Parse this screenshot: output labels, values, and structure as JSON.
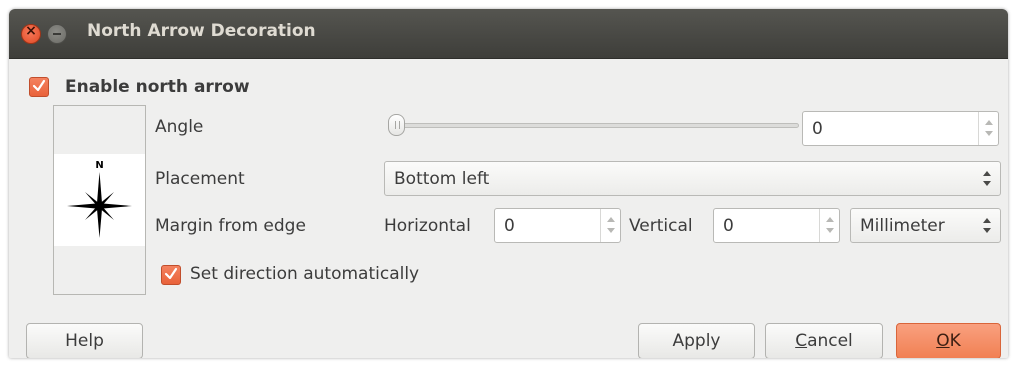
{
  "window": {
    "title": "North Arrow Decoration",
    "close_icon": "close-icon",
    "minimize_icon": "minimize-icon"
  },
  "enable": {
    "label": "Enable north arrow",
    "checked": true
  },
  "preview": {
    "north_letter": "N",
    "icon": "north-arrow-star-icon"
  },
  "angle": {
    "label": "Angle",
    "value": "0",
    "slider_level": 0
  },
  "placement": {
    "label": "Placement",
    "value": "Bottom left"
  },
  "margin": {
    "label": "Margin from edge",
    "horizontal_label": "Horizontal",
    "horizontal_value": "0",
    "vertical_label": "Vertical",
    "vertical_value": "0",
    "unit_value": "Millimeter"
  },
  "auto_direction": {
    "label": "Set direction automatically",
    "checked": true
  },
  "buttons": {
    "help": "Help",
    "apply": "Apply",
    "cancel_mnemonic": "C",
    "cancel_rest": "ancel",
    "ok_mnemonic": "O",
    "ok_rest": "K"
  },
  "colors": {
    "accent": "#f18053",
    "titlebar": "#4a4a46",
    "background": "#efefee"
  }
}
